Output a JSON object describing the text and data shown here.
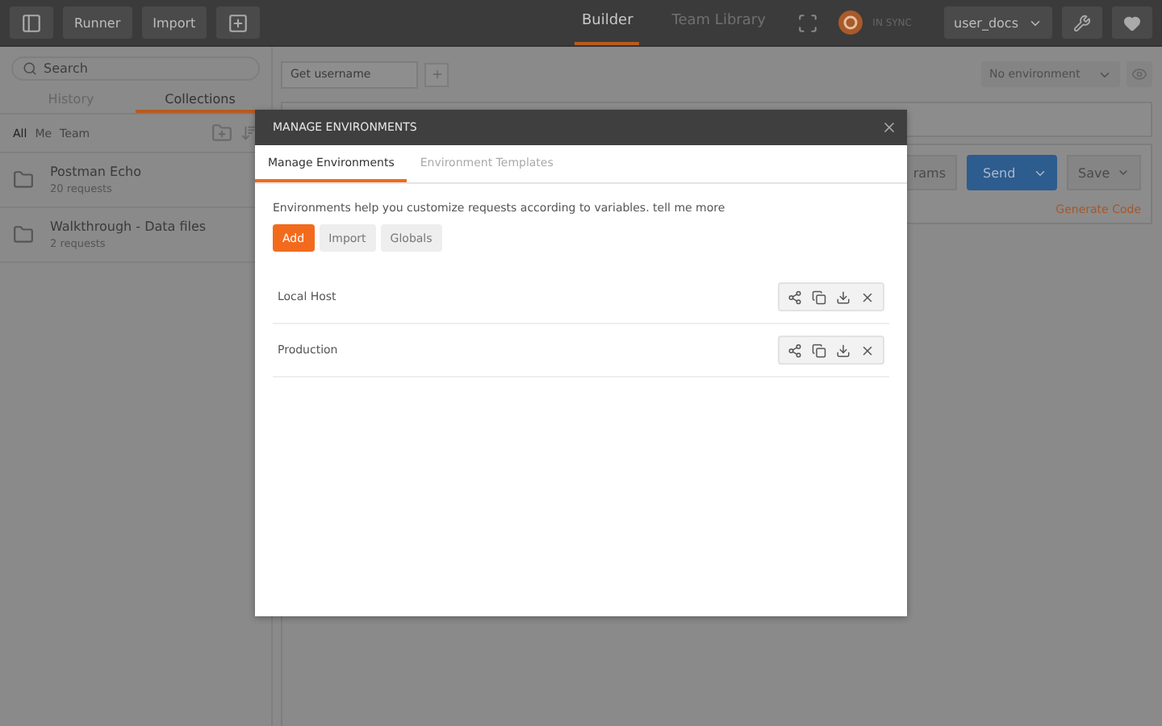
{
  "topbar": {
    "buttons": [
      "Runner",
      "Import"
    ],
    "nav": [
      {
        "label": "Builder",
        "selected": true
      },
      {
        "label": "Team Library",
        "selected": false
      }
    ],
    "sync": "IN SYNC",
    "user": "user_docs"
  },
  "sidebar": {
    "search": {
      "placeholder": "Search"
    },
    "tabs": [
      {
        "label": "History",
        "selected": false
      },
      {
        "label": "Collections",
        "selected": true
      }
    ],
    "filters": [
      {
        "label": "All",
        "selected": true
      },
      {
        "label": "Me",
        "selected": false
      },
      {
        "label": "Team",
        "selected": false
      }
    ],
    "collections": [
      {
        "name": "Postman Echo",
        "count": "20 requests"
      },
      {
        "name": "Walkthrough - Data files",
        "count": "2 requests"
      }
    ]
  },
  "main": {
    "request_tabs": [
      "Get username"
    ],
    "environment": "No environment",
    "params": "rams",
    "send": "Send",
    "save": "Save",
    "generate_code": "Generate Code"
  },
  "modal": {
    "title": "MANAGE ENVIRONMENTS",
    "tabs": [
      {
        "label": "Manage Environments",
        "selected": true
      },
      {
        "label": "Environment Templates",
        "selected": false
      }
    ],
    "description": "Environments help you customize requests according to variables. tell me more",
    "buttons": [
      {
        "label": "Add",
        "kind": "primary"
      },
      {
        "label": "Import",
        "kind": "default"
      },
      {
        "label": "Globals",
        "kind": "default"
      }
    ],
    "environments": [
      {
        "name": "Local Host"
      },
      {
        "name": "Production"
      }
    ]
  }
}
